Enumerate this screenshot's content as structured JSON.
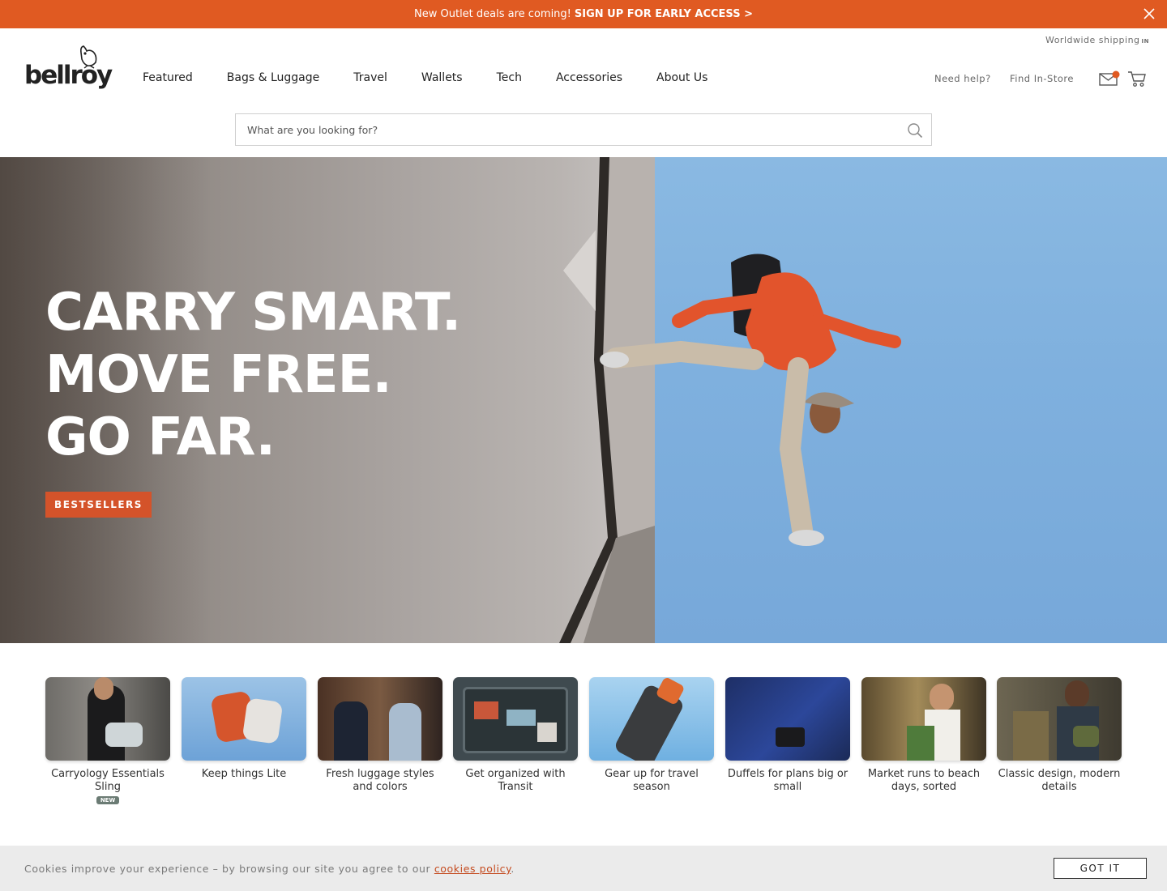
{
  "promo": {
    "text": "New Outlet deals are coming!",
    "link": "SIGN UP FOR EARLY ACCESS >",
    "bg": "#e05a22"
  },
  "header": {
    "shipping": "Worldwide shipping",
    "shipping_code": "IN",
    "logo": "bellroy",
    "nav": [
      "Featured",
      "Bags & Luggage",
      "Travel",
      "Wallets",
      "Tech",
      "Accessories",
      "About Us"
    ],
    "need_help": "Need help?",
    "find_store": "Find In-Store",
    "icons": [
      "mail-icon",
      "cart-icon",
      "search-icon",
      "close-icon",
      "owl-logo-icon"
    ]
  },
  "search": {
    "placeholder": "What are you looking for?"
  },
  "hero": {
    "line1": "CARRY SMART.",
    "line2": "MOVE FREE.",
    "line3": "GO FAR.",
    "cta": "BESTSELLERS",
    "accent": "#d4532a"
  },
  "tiles": [
    {
      "caption": "Carryology Essentials Sling",
      "badge": "NEW"
    },
    {
      "caption": "Keep things Lite"
    },
    {
      "caption": "Fresh luggage styles and colors"
    },
    {
      "caption": "Get organized with Transit"
    },
    {
      "caption": "Gear up for travel season"
    },
    {
      "caption": "Duffels for plans big or small"
    },
    {
      "caption": "Market runs to beach days, sorted"
    },
    {
      "caption": "Classic design, modern details"
    }
  ],
  "cookie": {
    "text": "Cookies improve your experience – by browsing our site you agree to our",
    "link": "cookies policy",
    "period": ".",
    "button": "GOT IT"
  }
}
